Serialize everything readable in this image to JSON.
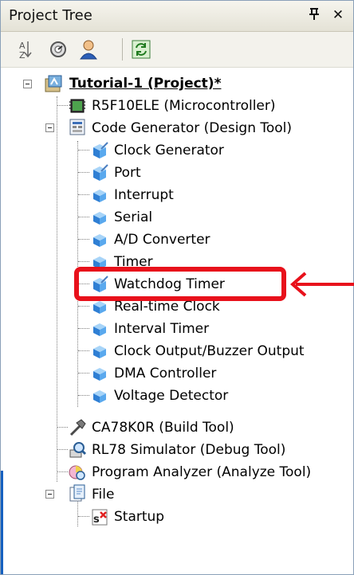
{
  "panel": {
    "title": "Project Tree",
    "pin_glyph": "ᵖ",
    "close_glyph": "✕"
  },
  "toolbar": {
    "icons": [
      "sort-icon",
      "properties-icon",
      "user-icon",
      "refresh-icon"
    ]
  },
  "tree": {
    "root": {
      "label": "Tutorial-1 (Project)*",
      "icon": "project-icon",
      "expanded": true
    },
    "microcontroller": {
      "label": "R5F10ELE (Microcontroller)",
      "icon": "chip-icon"
    },
    "code_generator": {
      "label": "Code Generator (Design Tool)",
      "icon": "code-generator-icon",
      "expanded": true,
      "children": [
        {
          "label": "Clock Generator",
          "icon": "peripheral-configured-icon"
        },
        {
          "label": "Port",
          "icon": "peripheral-configured-icon"
        },
        {
          "label": "Interrupt",
          "icon": "peripheral-icon"
        },
        {
          "label": "Serial",
          "icon": "peripheral-icon",
          "highlighted": true
        },
        {
          "label": "A/D Converter",
          "icon": "peripheral-icon"
        },
        {
          "label": "Timer",
          "icon": "peripheral-icon"
        },
        {
          "label": "Watchdog Timer",
          "icon": "peripheral-configured-icon"
        },
        {
          "label": "Real-time Clock",
          "icon": "peripheral-icon"
        },
        {
          "label": "Interval Timer",
          "icon": "peripheral-icon"
        },
        {
          "label": "Clock Output/Buzzer Output",
          "icon": "peripheral-icon"
        },
        {
          "label": "DMA Controller",
          "icon": "peripheral-icon"
        },
        {
          "label": "Voltage Detector",
          "icon": "peripheral-icon"
        }
      ]
    },
    "build_tool": {
      "label": "CA78K0R (Build Tool)",
      "icon": "hammer-icon"
    },
    "debug_tool": {
      "label": "RL78 Simulator (Debug Tool)",
      "icon": "simulator-icon"
    },
    "analyze_tool": {
      "label": "Program Analyzer (Analyze Tool)",
      "icon": "analyzer-icon"
    },
    "file": {
      "label": "File",
      "icon": "folder-icon",
      "expanded": true,
      "children": [
        {
          "label": "Startup",
          "icon": "startup-file-icon"
        }
      ]
    }
  },
  "colors": {
    "highlight": "#e8111b",
    "peripheral_blue": "#4a9ee6"
  }
}
